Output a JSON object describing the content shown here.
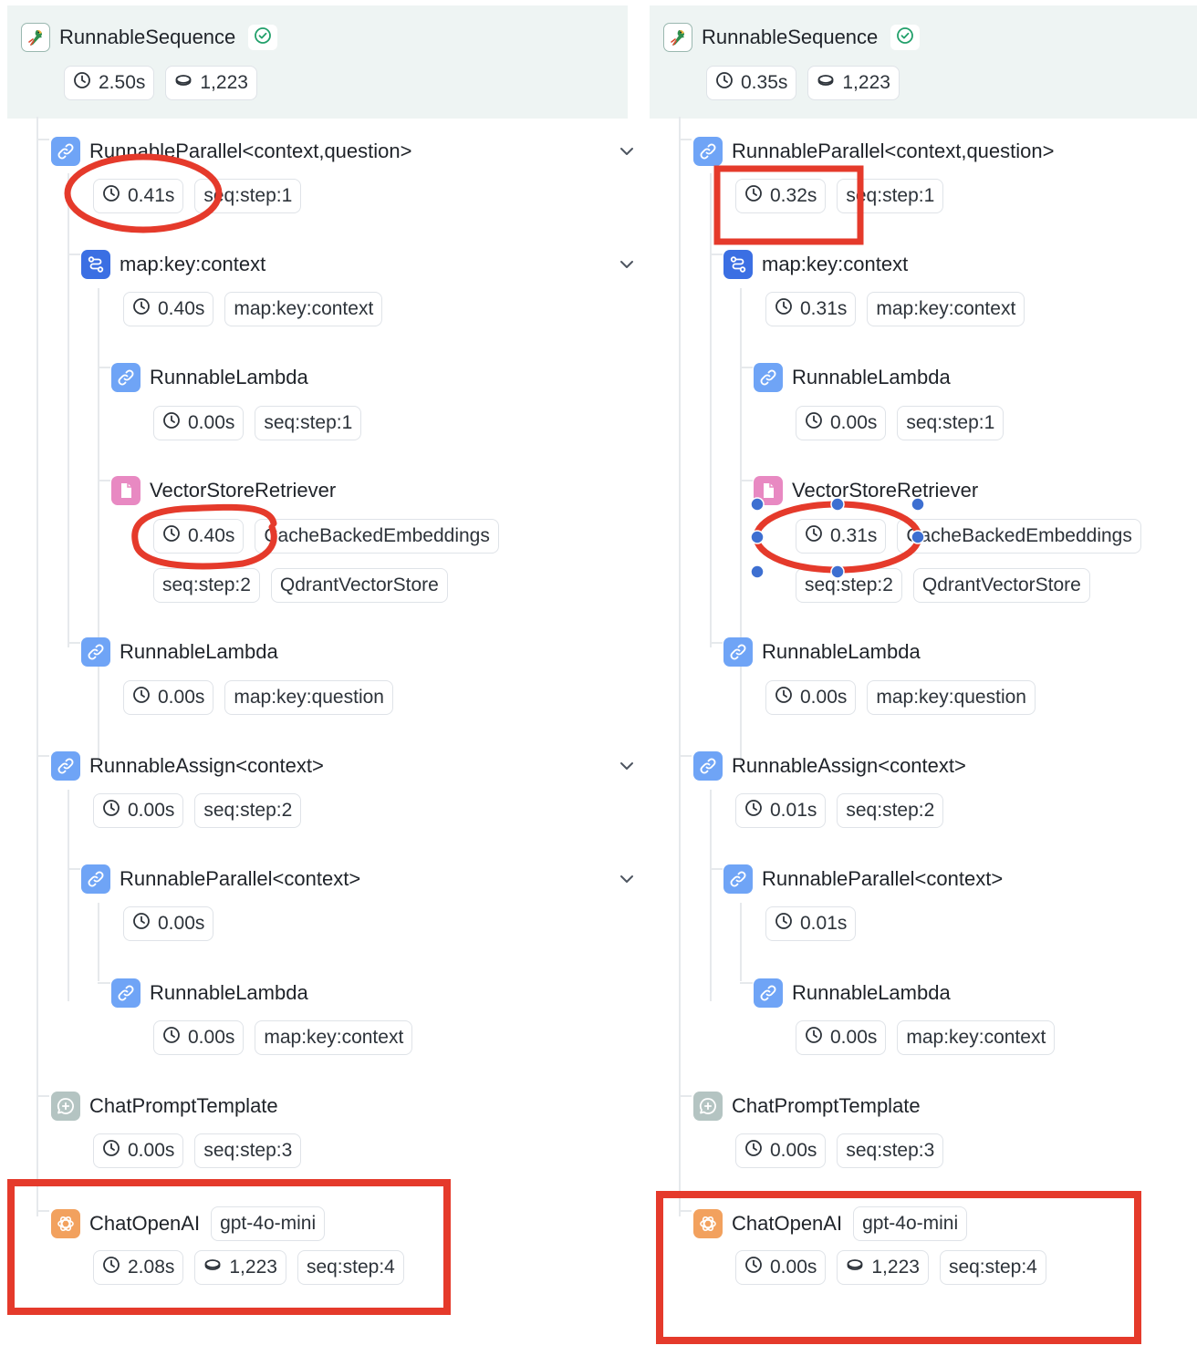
{
  "panels": [
    {
      "id": "left",
      "root": {
        "title": "RunnableSequence",
        "latency": "2.50s",
        "tokens": "1,223"
      },
      "steps": [
        {
          "title": "RunnableParallel<context,question>",
          "chips": [
            "0.41s",
            "seq:step:1"
          ]
        },
        {
          "title": "map:key:context",
          "chips": [
            "0.40s",
            "map:key:context"
          ]
        },
        {
          "title": "RunnableLambda",
          "chips": [
            "0.00s",
            "seq:step:1"
          ]
        },
        {
          "title": "VectorStoreRetriever",
          "chips": [
            "0.40s",
            "CacheBackedEmbeddings",
            "seq:step:2",
            "QdrantVectorStore"
          ]
        },
        {
          "title": "RunnableLambda",
          "chips": [
            "0.00s",
            "map:key:question"
          ]
        },
        {
          "title": "RunnableAssign<context>",
          "chips": [
            "0.00s",
            "seq:step:2"
          ]
        },
        {
          "title": "RunnableParallel<context>",
          "chips": [
            "0.00s"
          ]
        },
        {
          "title": "RunnableLambda",
          "chips": [
            "0.00s",
            "map:key:context"
          ]
        },
        {
          "title": "ChatPromptTemplate",
          "chips": [
            "0.00s",
            "seq:step:3"
          ]
        },
        {
          "title": "ChatOpenAI",
          "model": "gpt-4o-mini",
          "chips": [
            "2.08s",
            "1,223",
            "seq:step:4"
          ]
        }
      ]
    },
    {
      "id": "right",
      "root": {
        "title": "RunnableSequence",
        "latency": "0.35s",
        "tokens": "1,223"
      },
      "steps": [
        {
          "title": "RunnableParallel<context,question>",
          "chips": [
            "0.32s",
            "seq:step:1"
          ]
        },
        {
          "title": "map:key:context",
          "chips": [
            "0.31s",
            "map:key:context"
          ]
        },
        {
          "title": "RunnableLambda",
          "chips": [
            "0.00s",
            "seq:step:1"
          ]
        },
        {
          "title": "VectorStoreRetriever",
          "chips": [
            "0.31s",
            "CacheBackedEmbeddings",
            "seq:step:2",
            "QdrantVectorStore"
          ]
        },
        {
          "title": "RunnableLambda",
          "chips": [
            "0.00s",
            "map:key:question"
          ]
        },
        {
          "title": "RunnableAssign<context>",
          "chips": [
            "0.01s",
            "seq:step:2"
          ]
        },
        {
          "title": "RunnableParallel<context>",
          "chips": [
            "0.01s"
          ]
        },
        {
          "title": "RunnableLambda",
          "chips": [
            "0.00s",
            "map:key:context"
          ]
        },
        {
          "title": "ChatPromptTemplate",
          "chips": [
            "0.00s",
            "seq:step:3"
          ]
        },
        {
          "title": "ChatOpenAI",
          "model": "gpt-4o-mini",
          "chips": [
            "0.00s",
            "1,223",
            "seq:step:4"
          ]
        }
      ]
    }
  ],
  "icons": {
    "root": "parrot-icon",
    "status": "check-circle-icon",
    "latency": "clock-icon",
    "tokens": "token-coin-icon",
    "runnable": "link-icon",
    "map": "route-icon",
    "retriever": "document-icon",
    "prompt": "chat-bubble-plus-icon",
    "llm": "openai-icon",
    "expand": "chevron-down-icon"
  },
  "colors": {
    "root_band": "#eef4f3",
    "success": "#22a06b",
    "annotation": "#e53a2b",
    "selection_handle": "#3d6fd1"
  }
}
